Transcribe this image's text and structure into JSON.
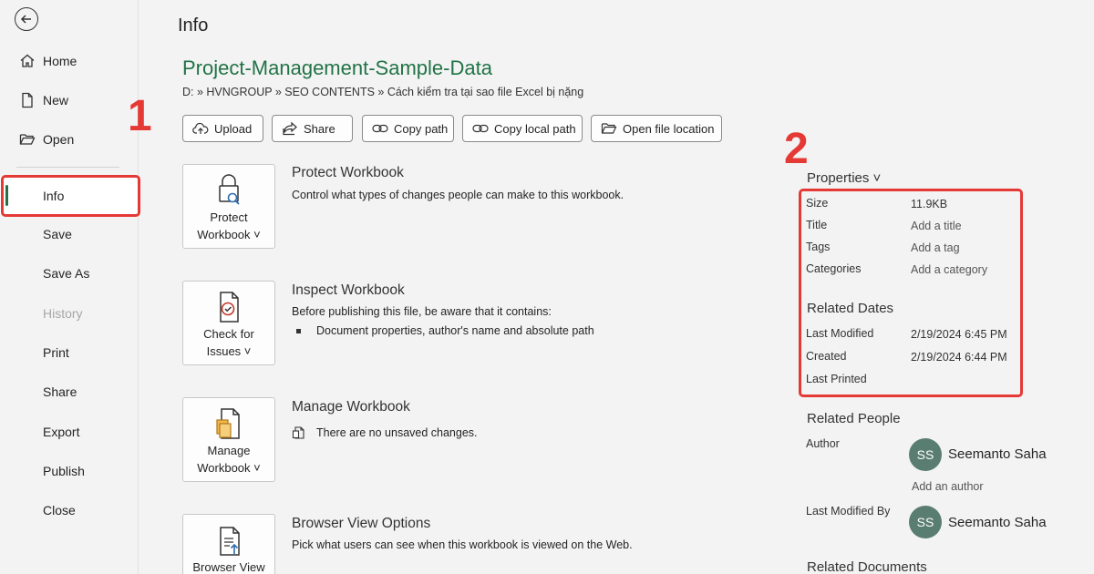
{
  "sidebar": {
    "items": [
      {
        "label": "Home",
        "icon": "home-icon"
      },
      {
        "label": "New",
        "icon": "new-document-icon"
      },
      {
        "label": "Open",
        "icon": "open-folder-icon"
      },
      {
        "label": "Info"
      },
      {
        "label": "Save"
      },
      {
        "label": "Save As"
      },
      {
        "label": "History",
        "disabled": true
      },
      {
        "label": "Print"
      },
      {
        "label": "Share"
      },
      {
        "label": "Export"
      },
      {
        "label": "Publish"
      },
      {
        "label": "Close"
      }
    ],
    "selected": "Info"
  },
  "annotations": {
    "left": "1",
    "right": "2",
    "color": "#e53935"
  },
  "main": {
    "page_title": "Info",
    "file_title": "Project-Management-Sample-Data",
    "breadcrumb": "D: » HVNGROUP » SEO CONTENTS » Cách kiểm tra tại sao file Excel bị nặng",
    "toolbar": [
      {
        "label": "Upload",
        "icon": "upload-cloud-icon"
      },
      {
        "label": "Share",
        "icon": "share-icon"
      },
      {
        "label": "Copy path",
        "icon": "link-icon"
      },
      {
        "label": "Copy local path",
        "icon": "link-icon"
      },
      {
        "label": "Open file location",
        "icon": "folder-icon"
      }
    ],
    "sections": [
      {
        "button_line1": "Protect",
        "button_line2": "Workbook ˅",
        "title": "Protect Workbook",
        "description": "Control what types of changes people can make to this workbook."
      },
      {
        "button_line1": "Check for",
        "button_line2": "Issues ˅",
        "title": "Inspect Workbook",
        "description": "Before publishing this file, be aware that it contains:",
        "bullet": "Document properties, author's name and absolute path"
      },
      {
        "button_line1": "Manage",
        "button_line2": "Workbook ˅",
        "title": "Manage Workbook",
        "description": "There are no unsaved changes."
      },
      {
        "button_line1": "Browser View",
        "title": "Browser View Options",
        "description": "Pick what users can see when this workbook is viewed on the Web."
      }
    ]
  },
  "properties": {
    "heading": "Properties ˅",
    "size_label": "Size",
    "size_value": "11.9KB",
    "title_label": "Title",
    "title_value": "Add a title",
    "tags_label": "Tags",
    "tags_value": "Add a tag",
    "categories_label": "Categories",
    "categories_value": "Add a category",
    "related_dates_heading": "Related Dates",
    "last_modified_label": "Last Modified",
    "last_modified_value": "2/19/2024 6:45 PM",
    "created_label": "Created",
    "created_value": "2/19/2024 6:44 PM",
    "last_printed_label": "Last Printed",
    "related_people_heading": "Related People",
    "author_label": "Author",
    "author_initials": "SS",
    "author_name": "Seemanto Saha",
    "add_author": "Add an author",
    "last_modified_by_label": "Last Modified By",
    "modifier_initials": "SS",
    "modifier_name": "Seemanto Saha",
    "related_documents_heading": "Related Documents"
  }
}
